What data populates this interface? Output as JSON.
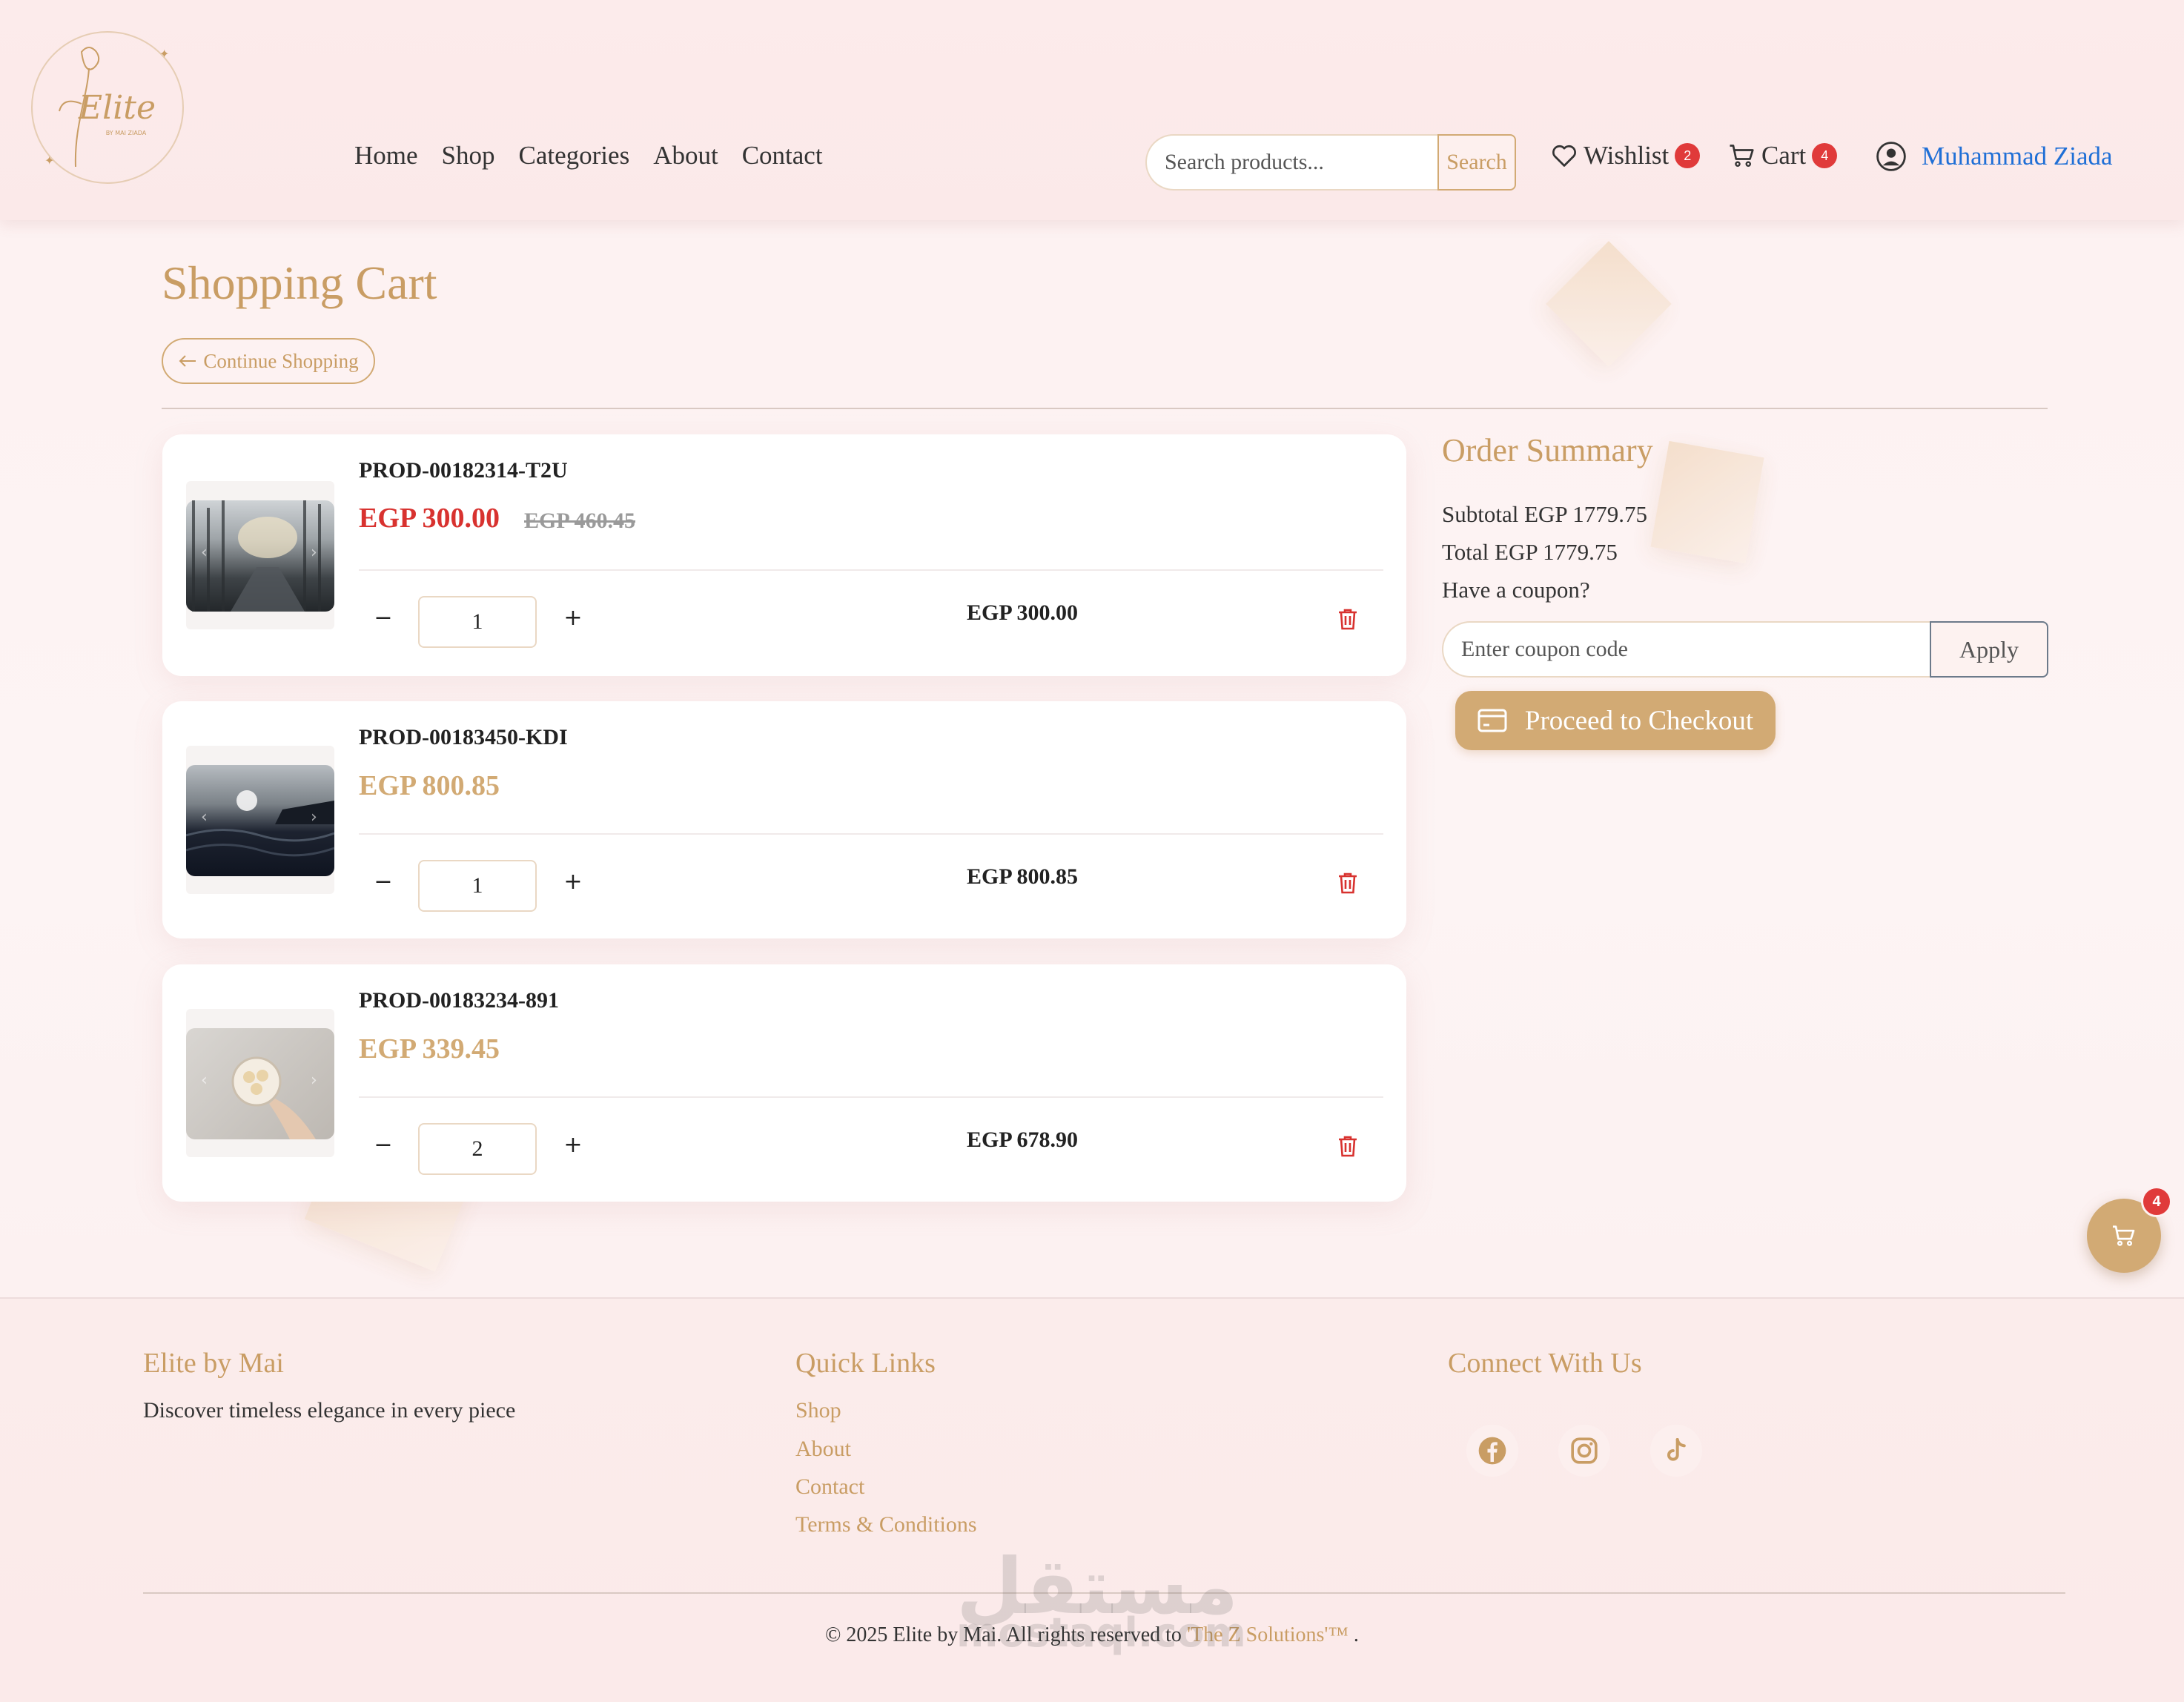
{
  "header": {
    "logo_text": "Elite",
    "logo_sub": "BY MAI ZIADA",
    "nav": [
      "Home",
      "Shop",
      "Categories",
      "About",
      "Contact"
    ],
    "search_placeholder": "Search products...",
    "search_button": "Search",
    "wishlist_label": "Wishlist",
    "wishlist_count": "2",
    "cart_label": "Cart",
    "cart_count": "4",
    "user_name": "Muhammad Ziada"
  },
  "page": {
    "title": "Shopping Cart",
    "continue_label": "Continue Shopping"
  },
  "cart_items": [
    {
      "name": "PROD-00182314-T2U",
      "price": "EGP 300.00",
      "old_price": "EGP 460.45",
      "qty": "1",
      "total": "EGP 300.00",
      "on_sale": true
    },
    {
      "name": "PROD-00183450-KDI",
      "price": "EGP 800.85",
      "old_price": "",
      "qty": "1",
      "total": "EGP 800.85",
      "on_sale": false
    },
    {
      "name": "PROD-00183234-891",
      "price": "EGP 339.45",
      "old_price": "",
      "qty": "2",
      "total": "EGP 678.90",
      "on_sale": false
    }
  ],
  "summary": {
    "title": "Order Summary",
    "subtotal": "Subtotal EGP 1779.75",
    "total": "Total EGP 1779.75",
    "coupon_question": "Have a coupon?",
    "coupon_placeholder": "Enter coupon code",
    "apply_label": "Apply",
    "checkout_label": "Proceed to Checkout"
  },
  "floating_cart_count": "4",
  "footer": {
    "brand_title": "Elite by Mai",
    "brand_tagline": "Discover timeless elegance in every piece",
    "links_title": "Quick Links",
    "links": [
      "Shop",
      "About",
      "Contact",
      "Terms & Conditions"
    ],
    "connect_title": "Connect With Us",
    "social_icons": [
      "facebook-icon",
      "instagram-icon",
      "tiktok-icon"
    ],
    "copyright_prefix": "© 2025 Elite by Mai. All rights reserved to",
    "copyright_company": "'The Z Solutions'™",
    "copyright_suffix": "."
  },
  "watermark": {
    "arabic": "مستقل",
    "latin": "mostaql.com"
  },
  "colors": {
    "accent": "#d2aa74",
    "sale": "#d8322f",
    "badge": "#e03a3a",
    "user_link": "#1f6fd6"
  }
}
